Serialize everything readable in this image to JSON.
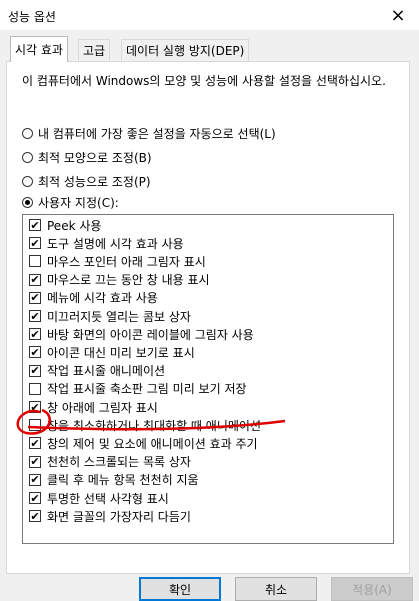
{
  "window": {
    "title": "성능 옵션",
    "close_icon": "×"
  },
  "tabs": [
    {
      "label": "시각 효과",
      "active": true
    },
    {
      "label": "고급",
      "active": false
    },
    {
      "label": "데이터 실행 방지(DEP)",
      "active": false
    }
  ],
  "description": "이 컴퓨터에서 Windows의 모양 및 성능에 사용할 설정을 선택하십시오.",
  "radios": [
    {
      "label": "내 컴퓨터에 가장 좋은 설정을 자동으로 선택(L)",
      "selected": false
    },
    {
      "label": "최적 모양으로 조정(B)",
      "selected": false
    },
    {
      "label": "최적 성능으로 조정(P)",
      "selected": false
    },
    {
      "label": "사용자 지정(C):",
      "selected": true
    }
  ],
  "options": [
    {
      "label": "Peek 사용",
      "checked": true
    },
    {
      "label": "도구 설명에 시각 효과 사용",
      "checked": true
    },
    {
      "label": "마우스 포인터 아래 그림자 표시",
      "checked": false
    },
    {
      "label": "마우스로 끄는 동안 창 내용 표시",
      "checked": true
    },
    {
      "label": "메뉴에 시각 효과 사용",
      "checked": true
    },
    {
      "label": "미끄러지듯 열리는 콤보 상자",
      "checked": true
    },
    {
      "label": "바탕 화면의 아이콘 레이블에 그림자 사용",
      "checked": true
    },
    {
      "label": "아이콘 대신 미리 보기로 표시",
      "checked": true
    },
    {
      "label": "작업 표시줄 애니메이션",
      "checked": true
    },
    {
      "label": "작업 표시줄 축소판 그림 미리 보기 저장",
      "checked": false
    },
    {
      "label": "창 아래에 그림자 표시",
      "checked": true
    },
    {
      "label": "창을 최소화하거나 최대화할 때 애니메이션",
      "checked": false
    },
    {
      "label": "창의 제어 및 요소에 애니메이션 효과 주기",
      "checked": true
    },
    {
      "label": "천천히 스크롤되는 목록 상자",
      "checked": true
    },
    {
      "label": "클릭 후 메뉴 항목 천천히 지움",
      "checked": true
    },
    {
      "label": "투명한 선택 사각형 표시",
      "checked": true
    },
    {
      "label": "화면 글꼴의 가장자리 다듬기",
      "checked": true
    }
  ],
  "buttons": {
    "ok": "확인",
    "cancel": "취소",
    "apply": "적용(A)"
  },
  "annotation_color": "#e00000"
}
